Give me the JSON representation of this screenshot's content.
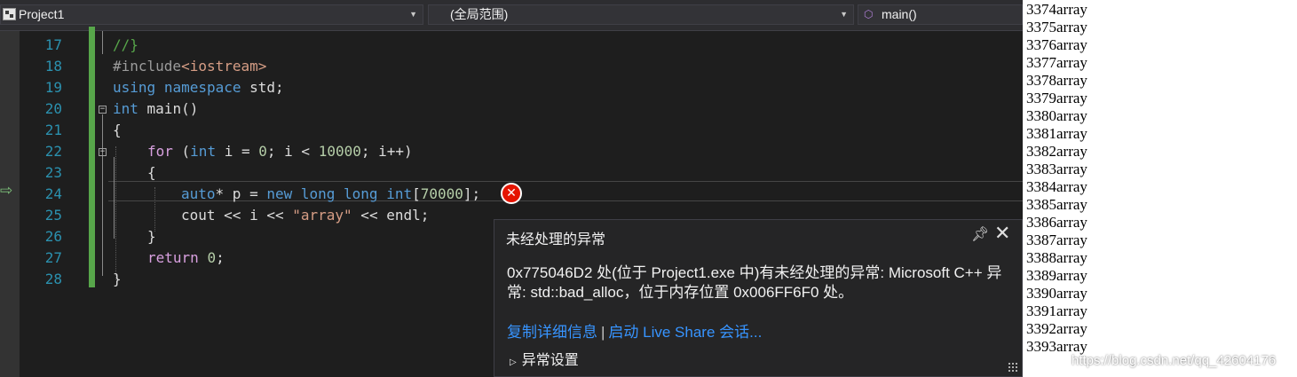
{
  "navbar": {
    "project": "Project1",
    "scope": "(全局范围)",
    "function": "main()"
  },
  "line_numbers": [
    "17",
    "18",
    "19",
    "20",
    "21",
    "22",
    "23",
    "24",
    "25",
    "26",
    "27",
    "28"
  ],
  "code": {
    "l17": "//}",
    "l18_a": "#include",
    "l18_b": "<iostream>",
    "l19_a": "using",
    "l19_b": "namespace",
    "l19_c": " std;",
    "l20_a": "int",
    "l20_b": " main()",
    "l21": "{",
    "l22_a": "for",
    "l22_b": " (",
    "l22_c": "int",
    "l22_d": " i = ",
    "l22_e": "0",
    "l22_f": "; i < ",
    "l22_g": "10000",
    "l22_h": "; i++)",
    "l23": "{",
    "l24_a": "auto",
    "l24_b": "* p = ",
    "l24_c": "new long long int",
    "l24_d": "[",
    "l24_e": "70000",
    "l24_f": "];",
    "l25_a": "cout << i << ",
    "l25_b": "\"array\"",
    "l25_c": " << endl;",
    "l26": "}",
    "l27_a": "return",
    "l27_b": " ",
    "l27_c": "0",
    "l27_d": ";",
    "l28": "}"
  },
  "exception_popup": {
    "title": "未经处理的异常",
    "message": "0x775046D2 处(位于 Project1.exe 中)有未经处理的异常: Microsoft C++ 异常: std::bad_alloc，位于内存位置 0x006FF6F0 处。",
    "link_copy": "复制详细信息",
    "separator": "|",
    "link_liveshare": "启动 Live Share 会话...",
    "settings": "异常设置"
  },
  "console_lines": [
    "3374array",
    "3375array",
    "3376array",
    "3377array",
    "3378array",
    "3379array",
    "3380array",
    "3381array",
    "3382array",
    "3383array",
    "3384array",
    "3385array",
    "3386array",
    "3387array",
    "3388array",
    "3389array",
    "3390array",
    "3391array",
    "3392array",
    "3393array"
  ],
  "watermark": "https://blog.csdn.net/qq_42604176",
  "icons": {
    "project": "project-icon",
    "function": "function-cube-icon",
    "exec": "execution-arrow-icon",
    "error": "error-icon",
    "pin": "pin-icon",
    "close": "close-icon",
    "expand": "expand-triangle-icon"
  }
}
